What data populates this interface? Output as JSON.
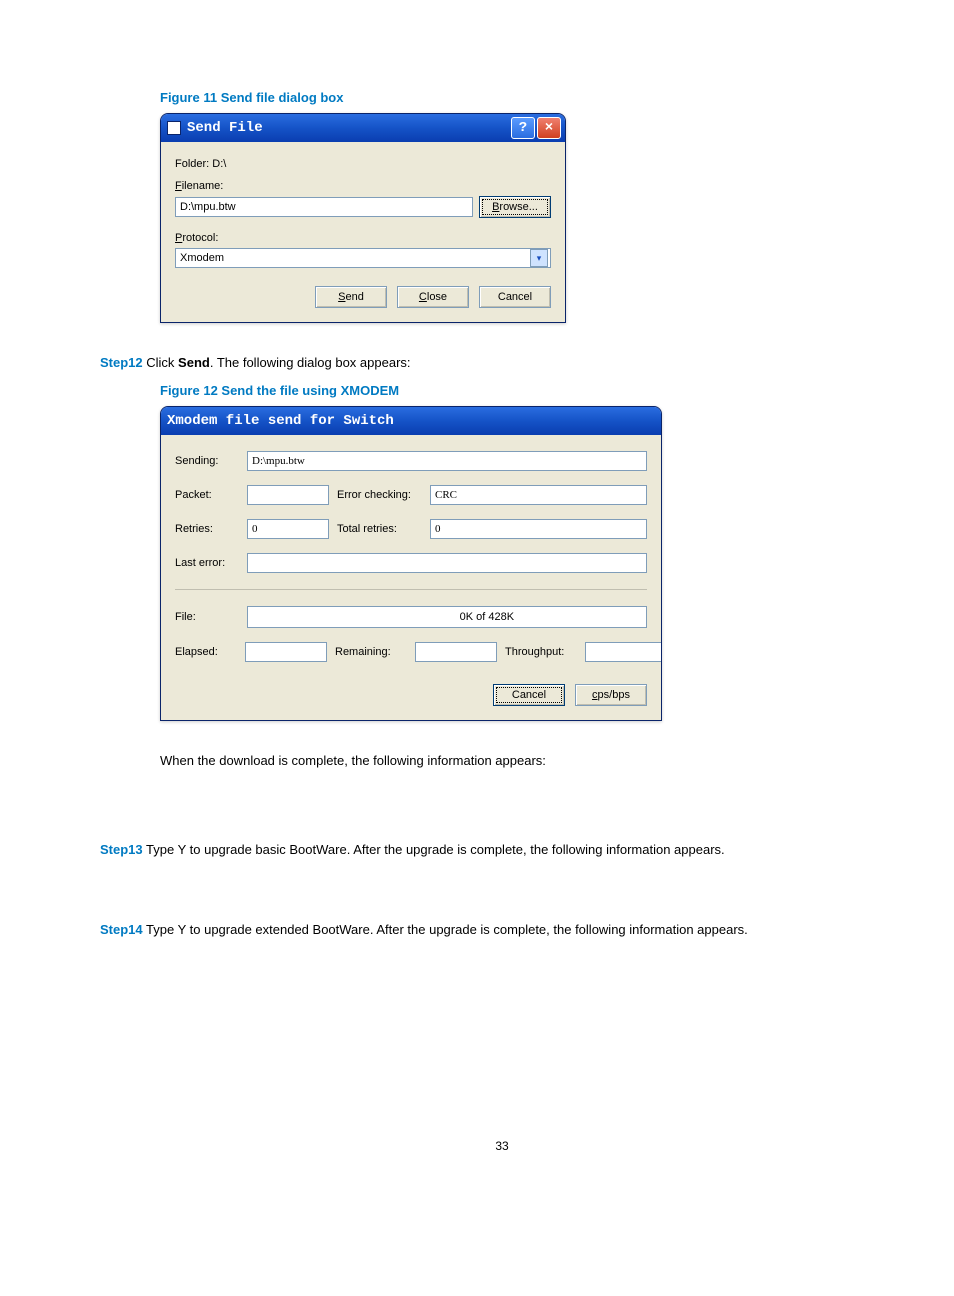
{
  "figure11": {
    "caption": "Figure 11 Send file dialog box",
    "title": "Send File",
    "folder_label": "Folder: D:\\",
    "filename_label_pre": "F",
    "filename_label_post": "ilename:",
    "filename_value": "D:\\mpu.btw",
    "browse_pre": "B",
    "browse_post": "rowse...",
    "protocol_label_pre": "P",
    "protocol_label_post": "rotocol:",
    "protocol_value": "Xmodem",
    "send_pre": "S",
    "send_post": "end",
    "close_pre": "C",
    "close_post": "lose",
    "cancel": "Cancel"
  },
  "step12": {
    "label": "Step12",
    "text_pre": "Click ",
    "bold": "Send",
    "text_post": ". The following dialog box appears:"
  },
  "figure12": {
    "caption": "Figure 12 Send the file using XMODEM",
    "title": "Xmodem file send for Switch",
    "sending_label": "Sending:",
    "sending_value": "D:\\mpu.btw",
    "packet_label": "Packet:",
    "packet_value": "",
    "errchk_label": "Error checking:",
    "errchk_value": "CRC",
    "retries_label": "Retries:",
    "retries_value": "0",
    "totretries_label": "Total retries:",
    "totretries_value": "0",
    "lasterror_label": "Last error:",
    "lasterror_value": "",
    "file_label": "File:",
    "file_progress_text": "0K of 428K",
    "elapsed_label": "Elapsed:",
    "elapsed_value": "",
    "remaining_label": "Remaining:",
    "remaining_value": "",
    "throughput_label": "Throughput:",
    "throughput_value": "",
    "cancel": "Cancel",
    "cpsbps_pre": "c",
    "cpsbps_post": "ps/bps"
  },
  "para_after12": "When the download is complete, the following information appears:",
  "step13": {
    "label": "Step13",
    "text": "Type Y to upgrade basic BootWare. After the upgrade is complete, the following information appears."
  },
  "step14": {
    "label": "Step14",
    "text": "Type Y to upgrade extended BootWare. After the upgrade is complete, the following information appears."
  },
  "page_number": "33"
}
